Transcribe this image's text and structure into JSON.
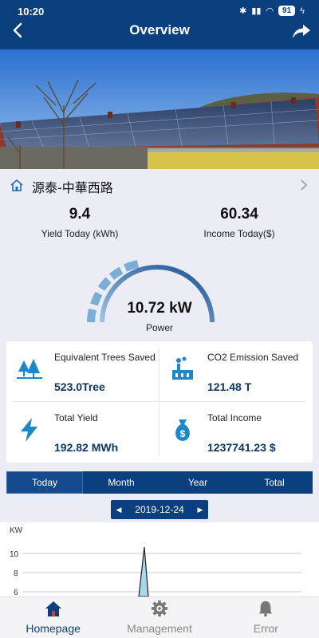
{
  "status_bar": {
    "time": "10:20",
    "battery": "91"
  },
  "header": {
    "title": "Overview"
  },
  "station": {
    "name": "源泰-中華西路"
  },
  "kpis": {
    "yield_today": {
      "value": "9.4",
      "label": "Yield Today (kWh)"
    },
    "income_today": {
      "value": "60.34",
      "label": "Income Today($)"
    }
  },
  "gauge": {
    "value": "10.72 kW",
    "label": "Power",
    "level": 0.55
  },
  "stats": {
    "trees": {
      "title": "Equivalent Trees Saved",
      "value": "523.0Tree"
    },
    "co2": {
      "title": "CO2 Emission Saved",
      "value": "121.48  T"
    },
    "total_yield": {
      "title": "Total Yield",
      "value": "192.82 MWh"
    },
    "total_income": {
      "title": "Total Income",
      "value": "1237741.23 $"
    }
  },
  "tabs": [
    "Today",
    "Month",
    "Year",
    "Total"
  ],
  "active_tab": "Today",
  "date_picker": {
    "date": "2019-12-24"
  },
  "chart_data": {
    "type": "area",
    "ylabel": "KW",
    "yticks": [
      "10",
      "8",
      "6"
    ],
    "ylim_visible": [
      5.5,
      11
    ],
    "peak_value": 10.72
  },
  "bottom_nav": {
    "homepage": "Homepage",
    "management": "Management",
    "error": "Error"
  },
  "colors": {
    "primary": "#0c3f7d",
    "accent": "#1a88c9",
    "background": "#ecedf4"
  }
}
